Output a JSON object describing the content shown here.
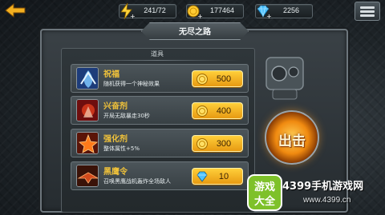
{
  "top_bar": {
    "resources": [
      {
        "icon": "lightning-icon",
        "value": "241/72"
      },
      {
        "icon": "gold-coin-icon",
        "value": "177464"
      },
      {
        "icon": "diamond-icon",
        "value": "2256"
      }
    ]
  },
  "panel": {
    "title": "无尽之路",
    "section_label": "道具"
  },
  "items": [
    {
      "name": "祝福",
      "desc": "随机获得一个神秘效果",
      "price": "500",
      "currency_icon": "gold-coin-icon"
    },
    {
      "name": "兴奋剂",
      "desc": "开局无敌暴走30秒",
      "price": "400",
      "currency_icon": "gold-coin-icon"
    },
    {
      "name": "强化剂",
      "desc": "整体属性+5%",
      "price": "300",
      "currency_icon": "gold-coin-icon"
    },
    {
      "name": "黑鹰令",
      "desc": "召唤黑鹰战机轰炸全场敌人",
      "price": "10",
      "currency_icon": "diamond-icon"
    }
  ],
  "start_button": {
    "label": "出击"
  },
  "watermark": {
    "logo_text": "游戏大全",
    "site_name": "4399手机游戏网",
    "url": "www.4399.cn"
  },
  "colors": {
    "accent_gold": "#f0c23a",
    "button_orange": "#e79a12"
  }
}
